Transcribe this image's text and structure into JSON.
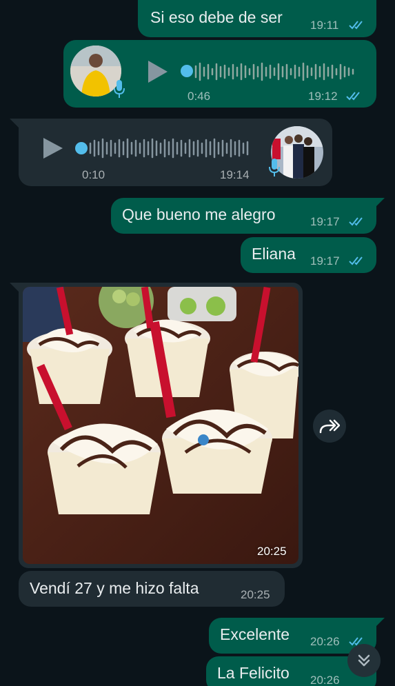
{
  "colors": {
    "outgoing": "#005c4b",
    "incoming": "#202c33",
    "background": "#0b141a",
    "read_ticks": "#53bdeb"
  },
  "messages": [
    {
      "type": "text",
      "direction": "out",
      "text": "Si eso debe de ser",
      "time": "19:11",
      "status": "read"
    },
    {
      "type": "voice",
      "direction": "out",
      "duration": "0:46",
      "time": "19:12",
      "status": "read"
    },
    {
      "type": "voice",
      "direction": "in",
      "duration": "0:10",
      "time": "19:14"
    },
    {
      "type": "text",
      "direction": "out",
      "text": "Que bueno me alegro",
      "time": "19:17",
      "status": "read"
    },
    {
      "type": "text",
      "direction": "out",
      "text": "Eliana",
      "time": "19:17",
      "status": "read"
    },
    {
      "type": "image",
      "direction": "in",
      "time": "20:25",
      "image_description": "frappes topped with whipped cream, chocolate syrup and red straws"
    },
    {
      "type": "text",
      "direction": "in",
      "text": "Vendí 27 y me hizo falta",
      "time": "20:25"
    },
    {
      "type": "text",
      "direction": "out",
      "text": "Excelente",
      "time": "20:26",
      "status": "read"
    },
    {
      "type": "text",
      "direction": "out",
      "text": "La Felicito",
      "time": "20:26",
      "status": "read"
    }
  ],
  "icons": {
    "forward": "forward-icon",
    "scroll_down": "double-chevron-down-icon",
    "mic": "mic-icon",
    "play": "play-icon"
  }
}
